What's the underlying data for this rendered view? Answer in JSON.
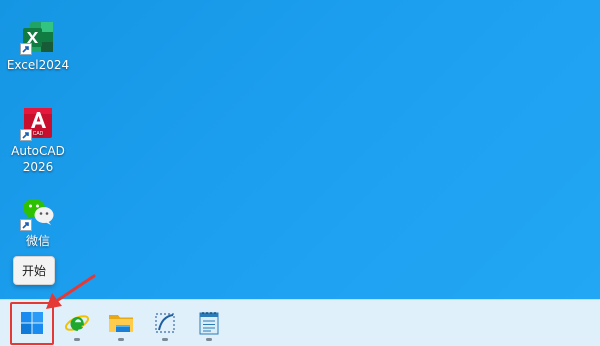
{
  "desktop": {
    "background_color": "#1d9ff0",
    "icons": [
      {
        "label": "Excel2024",
        "icon": "excel-icon"
      },
      {
        "label_line1": "AutoCAD",
        "label_line2": "2026",
        "icon": "autocad-icon"
      },
      {
        "label": "微信",
        "icon": "wechat-icon"
      }
    ]
  },
  "tooltip": {
    "text": "开始"
  },
  "taskbar": {
    "background_color": "#dff0fb",
    "items": [
      {
        "icon": "windows-start-icon"
      },
      {
        "icon": "internet-explorer-icon"
      },
      {
        "icon": "file-explorer-icon"
      },
      {
        "icon": "snipping-tool-icon"
      },
      {
        "icon": "notepad-icon"
      }
    ]
  },
  "annotation": {
    "color": "#e53935"
  }
}
